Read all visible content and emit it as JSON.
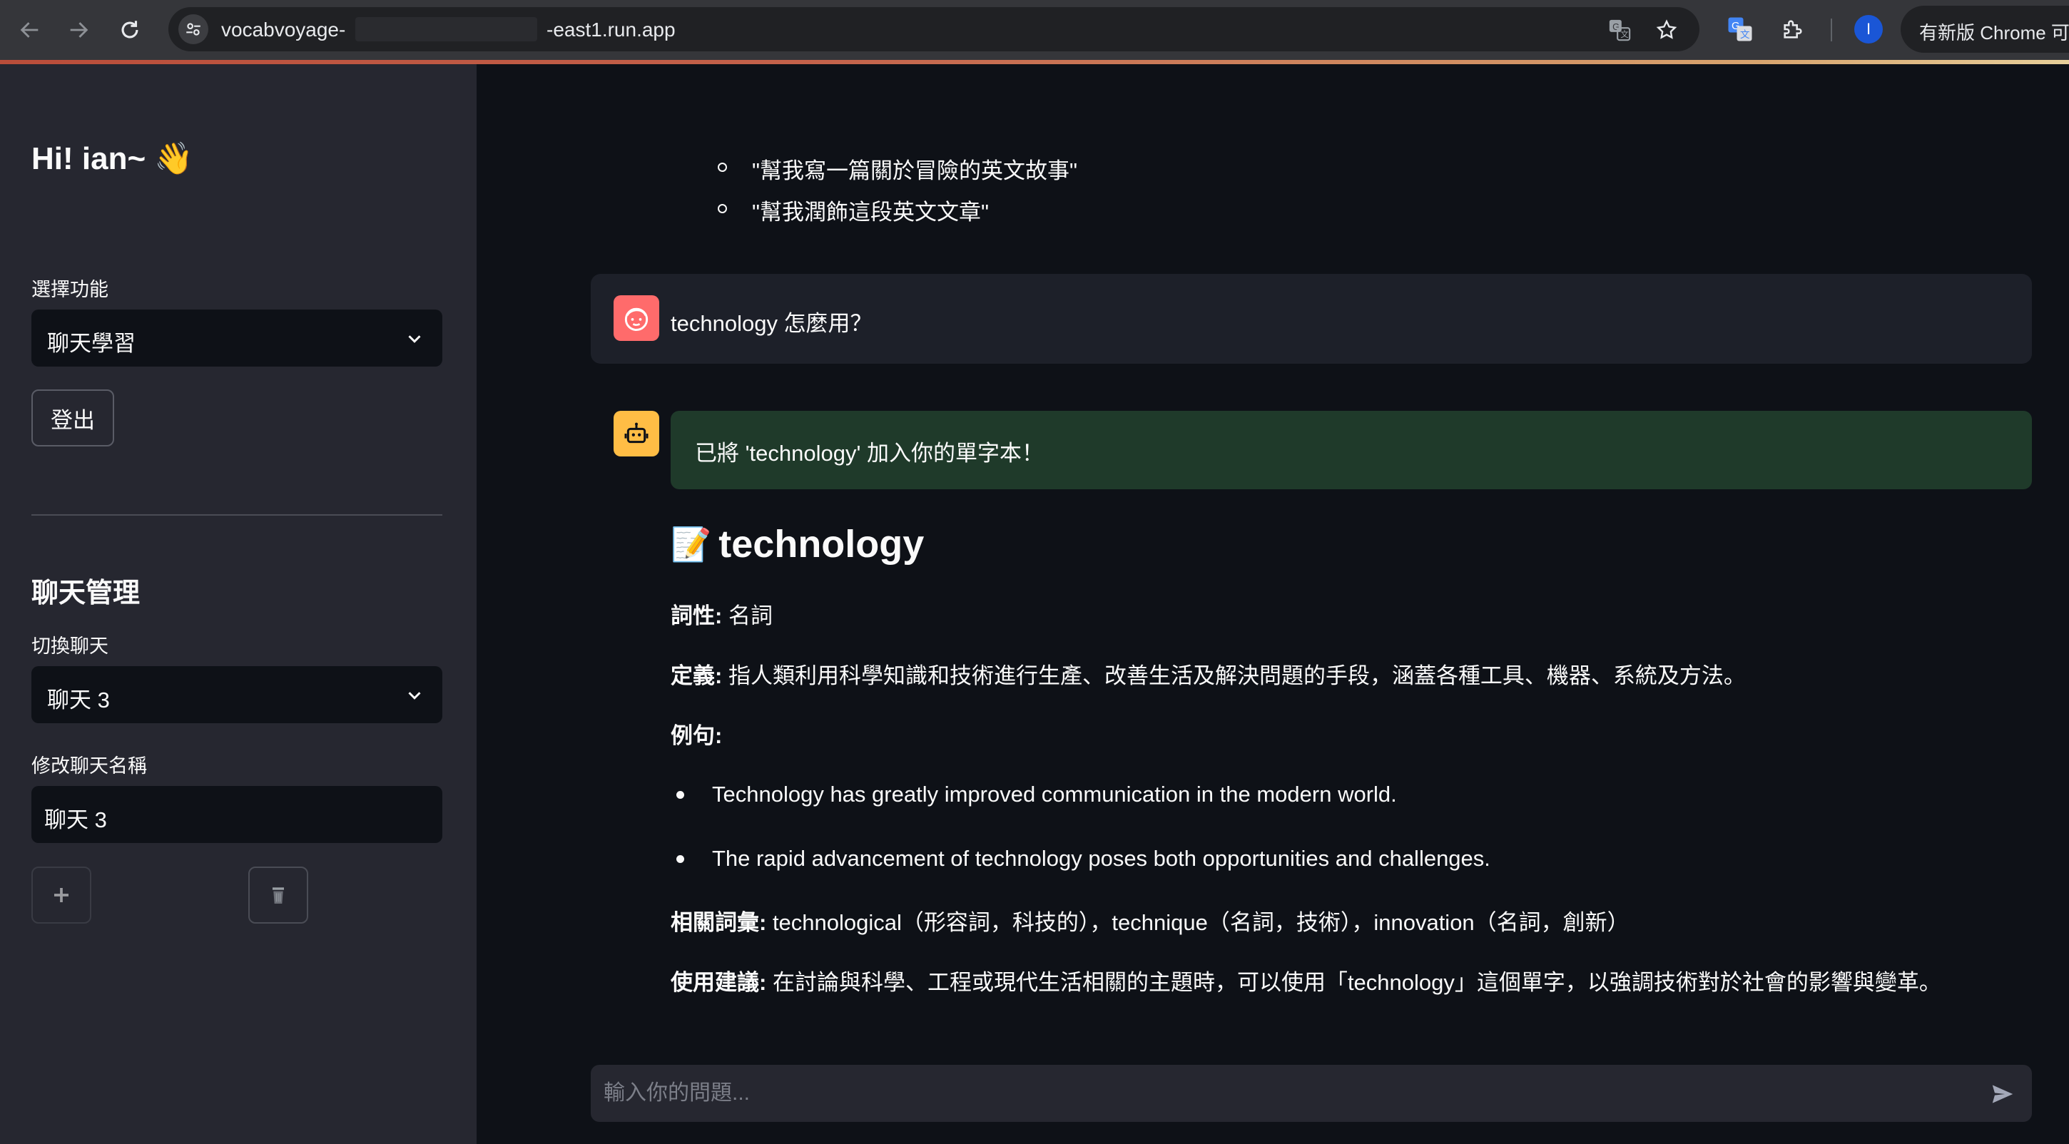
{
  "browser": {
    "url_prefix": "vocabvoyage-",
    "url_suffix": "-east1.run.app",
    "update_button": "有新版 Chrome 可",
    "profile_initial": "I",
    "icons": [
      "back-icon",
      "forward-icon",
      "reload-icon",
      "site-info-icon",
      "translate-icon",
      "bookmark-star-icon",
      "google-translate-extension-icon",
      "extensions-puzzle-icon"
    ]
  },
  "sidebar": {
    "greeting": "Hi! ian~ 👋",
    "feature_label": "選擇功能",
    "feature_value": "聊天學習",
    "logout_label": "登出",
    "section_title": "聊天管理",
    "switch_label": "切換聊天",
    "switch_value": "聊天 3",
    "rename_label": "修改聊天名稱",
    "rename_value": "聊天 3"
  },
  "chat": {
    "prior_suggestions": [
      "\"幫我寫一篇關於冒險的英文故事\"",
      "\"幫我潤飾這段英文文章\""
    ],
    "user_message": "technology 怎麼用？",
    "success_notice": "已將 'technology' 加入你的單字本！",
    "entry": {
      "emoji": "📝",
      "word": "technology",
      "pos_label": "詞性:",
      "pos_value": " 名詞",
      "definition_label": "定義:",
      "definition_value": " 指人類利用科學知識和技術進行生產、改善生活及解決問題的手段，涵蓋各種工具、機器、系統及方法。",
      "examples_label": "例句:",
      "examples": [
        "Technology has greatly improved communication in the modern world.",
        "The rapid advancement of technology poses both opportunities and challenges."
      ],
      "related_label": "相關詞彙:",
      "related_value": " technological（形容詞，科技的），technique（名詞，技術），innovation（名詞，創新）",
      "usage_label": "使用建議:",
      "usage_value": " 在討論與科學、工程或現代生活相關的主題時，可以使用「technology」這個單字，以強調技術對於社會的影響與變革。"
    },
    "input_placeholder": "輸入你的問題..."
  },
  "colors": {
    "sidebar_bg": "#262730",
    "main_bg": "#0e1117",
    "user_avatar": "#ff6b6b",
    "bot_avatar": "#ffbd45",
    "success_bg": "#1f3a2a"
  }
}
